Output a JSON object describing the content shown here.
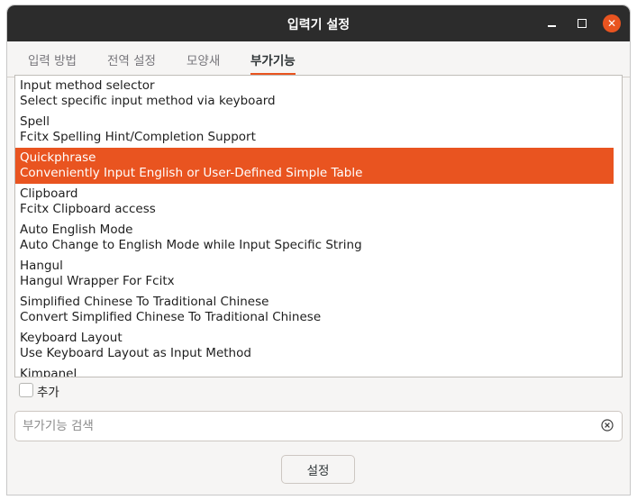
{
  "window": {
    "title": "입력기 설정"
  },
  "tabs": [
    {
      "label": "입력 방법",
      "active": false
    },
    {
      "label": "전역 설정",
      "active": false
    },
    {
      "label": "모양새",
      "active": false
    },
    {
      "label": "부가기능",
      "active": true
    }
  ],
  "addons": [
    {
      "name": "Input method selector",
      "description": "Select specific input method via keyboard",
      "selected": false
    },
    {
      "name": "Spell",
      "description": "Fcitx Spelling Hint/Completion Support",
      "selected": false
    },
    {
      "name": "Quickphrase",
      "description": "Conveniently Input English or User-Defined Simple Table",
      "selected": true
    },
    {
      "name": "Clipboard",
      "description": "Fcitx Clipboard access",
      "selected": false
    },
    {
      "name": "Auto English Mode",
      "description": "Auto Change to English Mode while Input Specific String",
      "selected": false
    },
    {
      "name": "Hangul",
      "description": "Hangul Wrapper For Fcitx",
      "selected": false
    },
    {
      "name": "Simplified Chinese To Traditional Chinese",
      "description": "Convert Simplified Chinese To Traditional Chinese",
      "selected": false
    },
    {
      "name": "Keyboard Layout",
      "description": "Use Keyboard Layout as Input Method",
      "selected": false
    },
    {
      "name": "Kimpanel",
      "description": "",
      "selected": false
    }
  ],
  "advanced": {
    "label": "추가",
    "checked": false
  },
  "search": {
    "placeholder": "부가기능 검색",
    "value": "",
    "clear_icon": "clear-circle-icon"
  },
  "footer": {
    "settings_label": "설정"
  },
  "colors": {
    "accent": "#e95420",
    "titlebar": "#2c2c2c"
  }
}
